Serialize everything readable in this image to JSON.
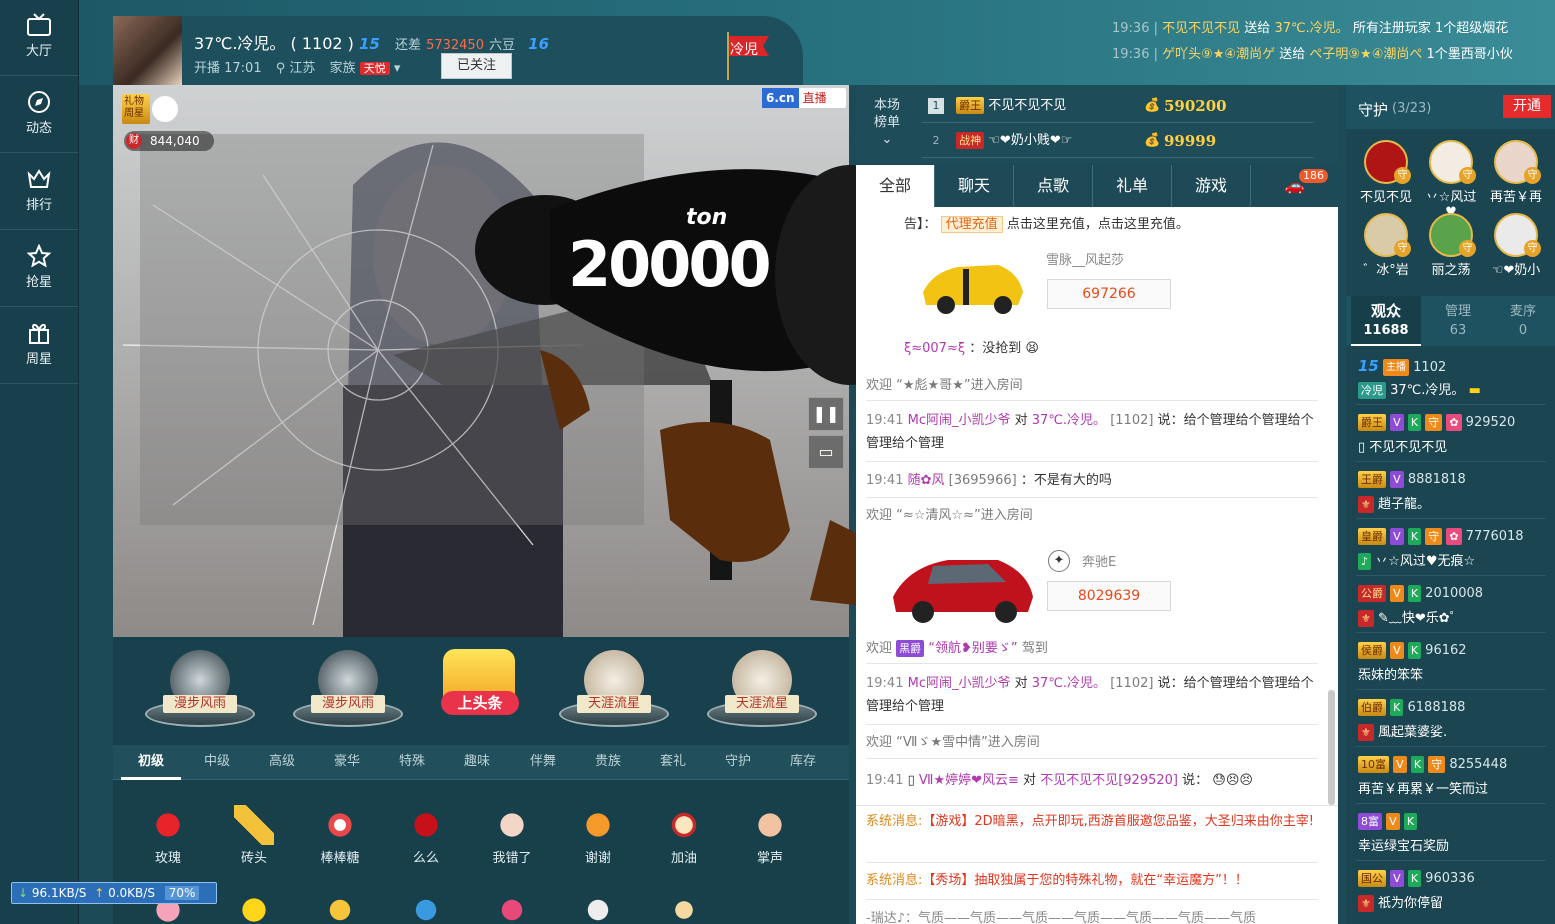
{
  "nav": [
    {
      "label": "大厅",
      "icon": "tv-icon"
    },
    {
      "label": "动态",
      "icon": "compass-icon"
    },
    {
      "label": "排行",
      "icon": "crown-icon"
    },
    {
      "label": "抢星",
      "icon": "star-icon"
    },
    {
      "label": "周星",
      "icon": "gift-box-icon"
    }
  ],
  "anchor": {
    "name": "37℃.冷児。",
    "room": "( 1102 )",
    "level_left": "15",
    "gap_label": "还差",
    "gap_value": "5732450",
    "gap_unit": "六豆",
    "level_right": "16",
    "start_time": "开播 17:01",
    "location": "江苏",
    "family_label": "家族",
    "family_tag": "天悦",
    "follow_button": "已关注",
    "flag_text": "冷児"
  },
  "ticker": [
    {
      "time": "19:36",
      "from": "不见不见不见",
      "verb": "送给",
      "to": "37℃.冷児。",
      "msg": "所有注册玩家 1个超级烟花"
    },
    {
      "time": "19:36",
      "from": "ゲ吖头⑨★④潮尚ゲ",
      "verb": "送给",
      "to": "ぺ子明⑨★④潮尚ぺ",
      "msg": "1个墨西哥小伙"
    }
  ],
  "video": {
    "logo_text": "6.cn",
    "logo_badge": "直播",
    "weekstar_text": "礼物周星",
    "wealth_icon": "财",
    "wealth_value": "844,040",
    "gift_big_text": "20000",
    "gift_small_text": "ton",
    "pause_icon": "pause-icon",
    "chat_icon": "comment-icon"
  },
  "stage": [
    {
      "label": "漫步风雨"
    },
    {
      "label": "漫步风雨"
    },
    {
      "label": "上头条"
    },
    {
      "label": "天涯流星"
    },
    {
      "label": "天涯流星"
    }
  ],
  "gift_tabs": [
    "初级",
    "中级",
    "高级",
    "豪华",
    "特殊",
    "趣味",
    "伴舞",
    "贵族",
    "套礼",
    "守护",
    "库存"
  ],
  "gifts": [
    {
      "label": "玫瑰"
    },
    {
      "label": "砖头"
    },
    {
      "label": "棒棒糖"
    },
    {
      "label": "么么"
    },
    {
      "label": "我错了"
    },
    {
      "label": "谢谢"
    },
    {
      "label": "加油"
    },
    {
      "label": "掌声"
    }
  ],
  "speed": {
    "down": "96.1KB/S",
    "up": "0.0KB/S",
    "pct": "70%"
  },
  "rank": {
    "label": "本场榜单",
    "rows": [
      {
        "n": "1",
        "badge": "爵王",
        "name": "不见不见不见",
        "coins": "590200"
      },
      {
        "n": "2",
        "badge": "战神",
        "name": "☜❤奶小贱❤☞",
        "coins": "99999"
      }
    ]
  },
  "chat_tabs": [
    "全部",
    "聊天",
    "点歌",
    "礼单",
    "游戏"
  ],
  "chat_tab_count": "186",
  "chat": {
    "notice_prefix": "告】：",
    "notice_tag": "代理充值",
    "notice_text": "点击这里充值，点击这里充值。",
    "car1_owner": "雪脉__风起莎",
    "car1_value": "697266",
    "line_grab_user": "ξ≈007≈ξ",
    "line_grab_text": "：没抢到",
    "welcome1": "欢迎 “★彪★哥★”进入房间",
    "msg1": {
      "time": "19:41",
      "user": "Mc阿闹_小凯少爷",
      "mid": "对",
      "to": "37℃.冷児。",
      "room": "[1102]",
      "text": "说：给个管理给个管理给个管理给个管理"
    },
    "msg2": {
      "time": "19:41",
      "user": "随✿风",
      "room": "[3695966]",
      "text": "：不是有大的吗"
    },
    "welcome2": "欢迎 “≈☆清风☆≈”进入房间",
    "car2_brand": "奔驰E",
    "car2_value": "8029639",
    "welcome3_pre": "欢迎",
    "welcome3_badge": "黑爵",
    "welcome3_name": "“领航❥别要ゞ”",
    "welcome3_post": "驾到",
    "msg3": {
      "time": "19:41",
      "user": "Mc阿闹_小凯少爷",
      "mid": "对",
      "to": "37℃.冷児。",
      "room": "[1102]",
      "text": "说：给个管理给个管理给个管理给个管理"
    },
    "welcome4": "欢迎 “Ⅶゞ★雪中情”进入房间",
    "msg4": {
      "time": "19:41",
      "user": "Ⅶ★婷婷❤风云≡",
      "mid": "对",
      "to": "不见不见不见[929520]",
      "text": "说："
    }
  },
  "sys": [
    {
      "k": "系统消息:",
      "text": "【游戏】2D暗黑，点开即玩,西游首服邀您品鉴，大圣归来由你主宰!"
    },
    {
      "k": "系统消息:",
      "text": "【秀场】抽取独属于您的特殊礼物，就在“幸运魔方”！！"
    },
    {
      "k": "",
      "text": "-瑞达♪：气质——气质——气质——气质——气质——气质——气质"
    }
  ],
  "guard": {
    "title": "守护",
    "count": "(3/23)",
    "open_button": "开通",
    "members": [
      {
        "name": "不见不见"
      },
      {
        "name": "丷☆风过♥"
      },
      {
        "name": "再苦￥再"
      },
      {
        "name": "゛冰°岩"
      },
      {
        "name": "丽之荡"
      },
      {
        "name": "☜❤奶小"
      }
    ],
    "badge": "守"
  },
  "aud_tabs": [
    {
      "label": "观众",
      "count": "11688"
    },
    {
      "label": "管理",
      "count": "63"
    },
    {
      "label": "麦序",
      "count": "0"
    }
  ],
  "audience": [
    {
      "b1": "15",
      "num": "1102",
      "name": "37℃.冷児。"
    },
    {
      "b1": "爵王",
      "num": "929520",
      "name": "不见不见不见"
    },
    {
      "b1": "王爵",
      "num": "8881818",
      "name": "趙子龍。"
    },
    {
      "b1": "皇爵",
      "num": "7776018",
      "name": "丷☆风过♥无痕☆"
    },
    {
      "b1": "公爵",
      "num": "2010008",
      "name": "✎﹏快❤乐✿゜"
    },
    {
      "b1": "侯爵",
      "num": "96162",
      "name": "炁妹的笨笨"
    },
    {
      "b1": "伯爵",
      "num": "6188188",
      "name": "風起葉婆娑."
    },
    {
      "b1": "10富",
      "num": "8255448",
      "name": "再苦￥再累￥一笑而过"
    },
    {
      "b1": "8富",
      "num": "",
      "name": "幸运绿宝石奖励"
    },
    {
      "b1": "国公",
      "num": "960336",
      "name": "祇为你停留"
    }
  ],
  "colors": {
    "brand": "#2b6bd3",
    "accent": "#e02a2a",
    "panel": "#1b4551"
  }
}
